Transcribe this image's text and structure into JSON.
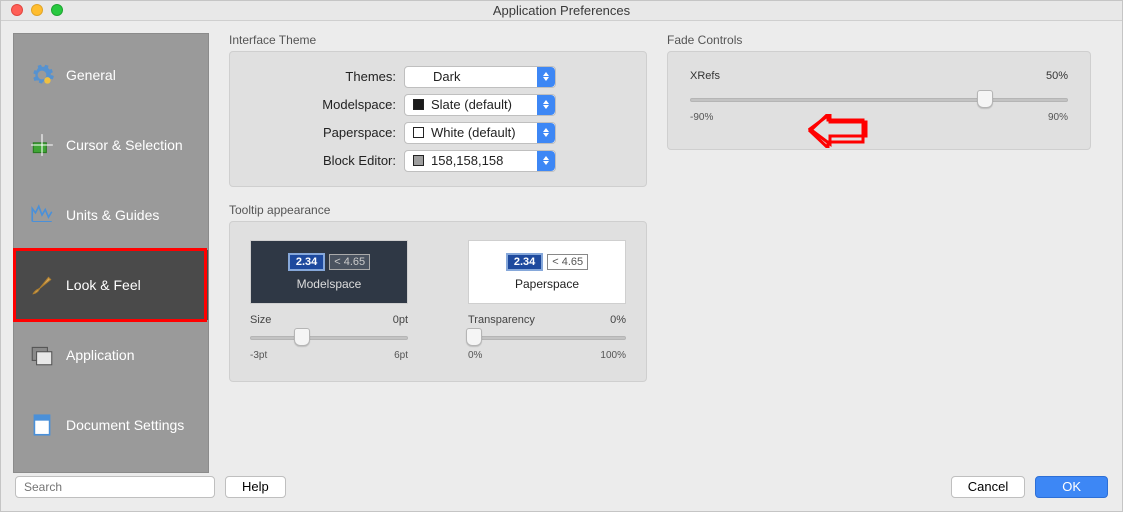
{
  "window": {
    "title": "Application Preferences"
  },
  "sidebar": {
    "items": [
      {
        "label": "General"
      },
      {
        "label": "Cursor & Selection"
      },
      {
        "label": "Units & Guides"
      },
      {
        "label": "Look & Feel"
      },
      {
        "label": "Application"
      },
      {
        "label": "Document Settings"
      }
    ]
  },
  "interface_theme": {
    "group_label": "Interface Theme",
    "labels": {
      "themes": "Themes:",
      "modelspace": "Modelspace:",
      "paperspace": "Paperspace:",
      "block_editor": "Block Editor:"
    },
    "values": {
      "themes": "Dark",
      "modelspace": "Slate (default)",
      "paperspace": "White (default)",
      "block_editor": "158,158,158"
    },
    "swatches": {
      "modelspace": "#1b1b1b",
      "paperspace": "#ffffff",
      "block_editor": "#9e9e9e"
    }
  },
  "fade": {
    "group_label": "Fade Controls",
    "name": "XRefs",
    "value_label": "50%",
    "min": "-90%",
    "max": "90%",
    "thumb_pct": 78
  },
  "tooltip": {
    "group_label": "Tooltip appearance",
    "badge1": "2.34",
    "badge2": "< 4.65",
    "modelspace_label": "Modelspace",
    "paperspace_label": "Paperspace",
    "size": {
      "label": "Size",
      "value": "0pt",
      "min": "-3pt",
      "max": "6pt",
      "thumb_pct": 33
    },
    "transparency": {
      "label": "Transparency",
      "value": "0%",
      "min": "0%",
      "max": "100%",
      "thumb_pct": 4
    }
  },
  "footer": {
    "search_placeholder": "Search",
    "help": "Help",
    "cancel": "Cancel",
    "ok": "OK"
  }
}
